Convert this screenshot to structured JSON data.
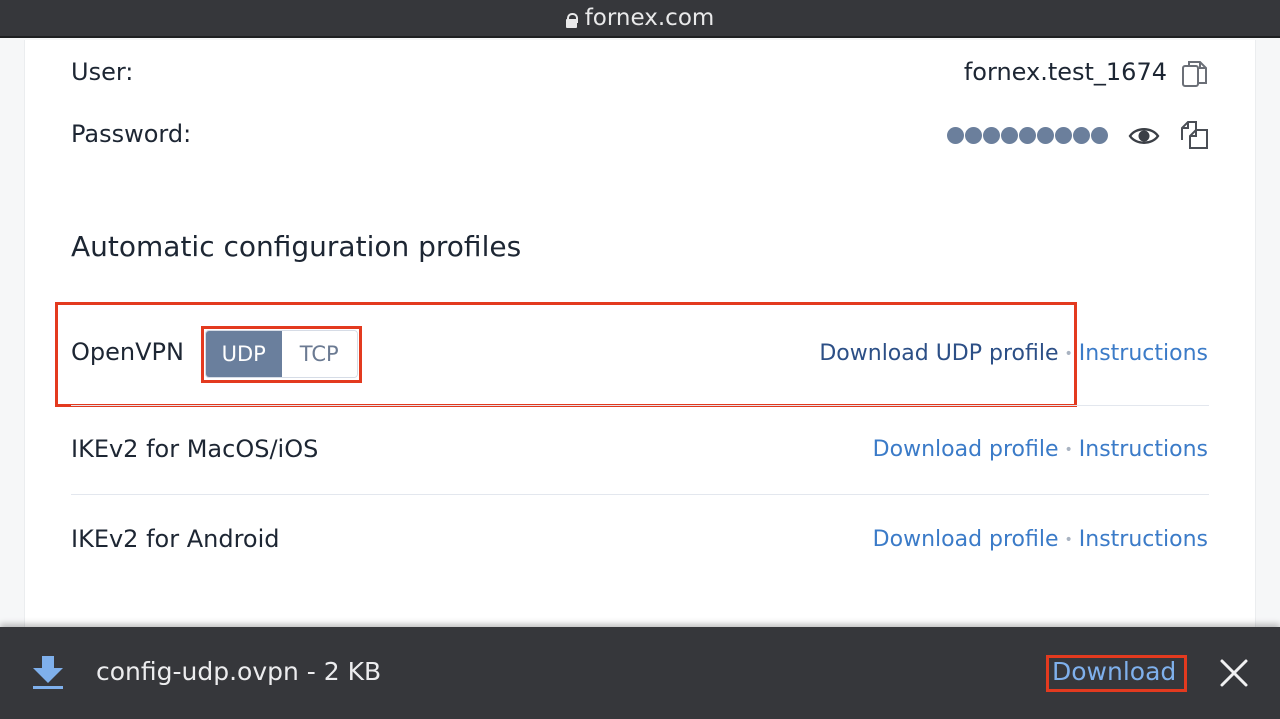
{
  "browser": {
    "url": "fornex.com",
    "lock_icon": "lock-icon"
  },
  "credentials": {
    "user_label": "User:",
    "user_value": "fornex.test_1674",
    "password_label": "Password:",
    "password_mask_count": 9,
    "icons": [
      "copy-icon",
      "eye-icon",
      "copy-icon"
    ]
  },
  "profiles": {
    "heading": "Automatic configuration profiles",
    "items": [
      {
        "name": "OpenVPN",
        "protocols": [
          "UDP",
          "TCP"
        ],
        "selected_protocol": "UDP",
        "download_label": "Download UDP profile",
        "instructions_label": "Instructions"
      },
      {
        "name": "IKEv2 for MacOS/iOS",
        "download_label": "Download profile",
        "instructions_label": "Instructions"
      },
      {
        "name": "IKEv2 for Android",
        "download_label": "Download profile",
        "instructions_label": "Instructions"
      }
    ],
    "separator": "•"
  },
  "download_bar": {
    "file_info": "config-udp.ovpn - 2 KB",
    "download_label": "Download",
    "icon": "download-icon",
    "close_icon": "close-icon"
  },
  "colors": {
    "accent_link": "#3b7bc8",
    "highlight": "#e33a1f",
    "segment_active": "#6a7f9d",
    "download_link": "#7fb0ec"
  }
}
